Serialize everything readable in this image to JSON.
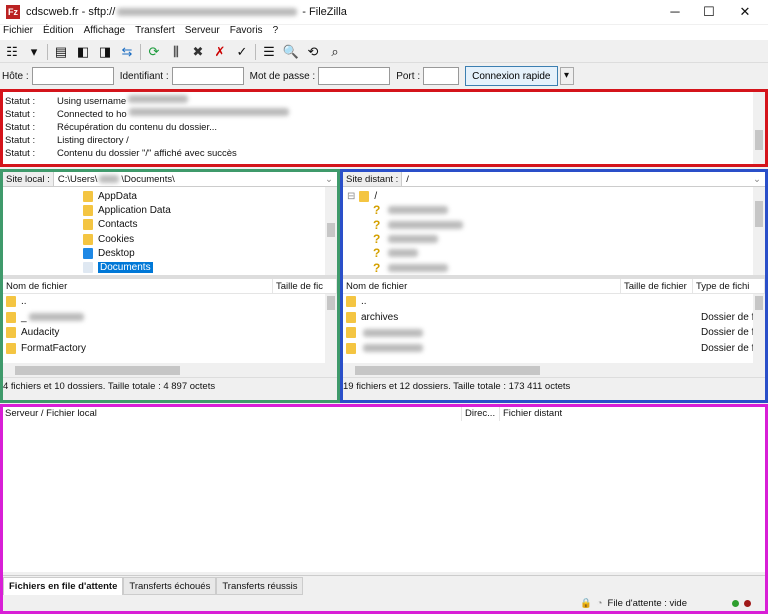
{
  "window": {
    "title_prefix": "cdscweb.fr - sftp://",
    "title_suffix": " - FileZilla",
    "minimize": "─",
    "maximize": "☐",
    "close": "✕"
  },
  "menu": [
    "Fichier",
    "Édition",
    "Affichage",
    "Transfert",
    "Serveur",
    "Favoris",
    "?"
  ],
  "toolbar": [
    {
      "name": "site-manager-icon",
      "glyph": "☷"
    },
    {
      "name": "dropdown-icon",
      "glyph": "▾"
    },
    {
      "name": "toggle-log-icon",
      "glyph": "▤"
    },
    {
      "name": "toggle-local-tree-icon",
      "glyph": "◧"
    },
    {
      "name": "toggle-remote-tree-icon",
      "glyph": "◨"
    },
    {
      "name": "toggle-queue-icon",
      "glyph": "⇆"
    },
    {
      "name": "refresh-icon",
      "glyph": "⟳"
    },
    {
      "name": "process-queue-icon",
      "glyph": "⫼"
    },
    {
      "name": "cancel-icon",
      "glyph": "✖"
    },
    {
      "name": "disconnect-icon",
      "glyph": "✗"
    },
    {
      "name": "reconnect-icon",
      "glyph": "✓"
    },
    {
      "name": "filter-icon",
      "glyph": "☰"
    },
    {
      "name": "compare-icon",
      "glyph": "🔍"
    },
    {
      "name": "sync-browse-icon",
      "glyph": "⟲"
    },
    {
      "name": "find-files-icon",
      "glyph": "⌕"
    }
  ],
  "quickconnect": {
    "host_label": "Hôte :",
    "user_label": "Identifiant :",
    "pass_label": "Mot de passe :",
    "port_label": "Port :",
    "host": "",
    "user": "",
    "password": "",
    "port": "",
    "button": "Connexion rapide",
    "dropdown": "▾"
  },
  "log": [
    {
      "k": "Statut :",
      "v": "Using username ",
      "blur": true
    },
    {
      "k": "Statut :",
      "v": "Connected to ho",
      "blur": true
    },
    {
      "k": "Statut :",
      "v": "Récupération du contenu du dossier..."
    },
    {
      "k": "Statut :",
      "v": "Listing directory /"
    },
    {
      "k": "Statut :",
      "v": "Contenu du dossier \"/\" affiché avec succès"
    }
  ],
  "local": {
    "site_label": "Site local :",
    "path_prefix": "C:\\Users\\",
    "path_suffix": "\\Documents\\",
    "tree": [
      "AppData",
      "Application Data",
      "Contacts",
      "Cookies",
      "Desktop",
      "Documents"
    ],
    "selected": "Documents",
    "columns": [
      "Nom de fichier",
      "Taille de fic"
    ],
    "files": [
      "..",
      "_",
      "Audacity",
      "FormatFactory"
    ],
    "status": "4 fichiers et 10 dossiers. Taille totale : 4 897 octets"
  },
  "remote": {
    "site_label": "Site distant :",
    "path": "/",
    "tree_root": "/",
    "columns": [
      "Nom de fichier",
      "Taille de fichier",
      "Type de fichi"
    ],
    "files": [
      {
        "name": "..",
        "type": ""
      },
      {
        "name": "archives",
        "type": "Dossier de fi"
      },
      {
        "name": "",
        "type": "Dossier de fi"
      },
      {
        "name": "",
        "type": "Dossier de fi"
      }
    ],
    "status": "19 fichiers et 12 dossiers. Taille totale : 173 411 octets"
  },
  "queue": {
    "columns": [
      "Serveur / Fichier local",
      "Direc...",
      "Fichier distant"
    ],
    "tabs": [
      "Fichiers en file d'attente",
      "Transferts échoués",
      "Transferts réussis"
    ],
    "status": "File d'attente : vide",
    "colors": {
      "connected": "#2e9e2e",
      "activity": "#a01818"
    }
  }
}
